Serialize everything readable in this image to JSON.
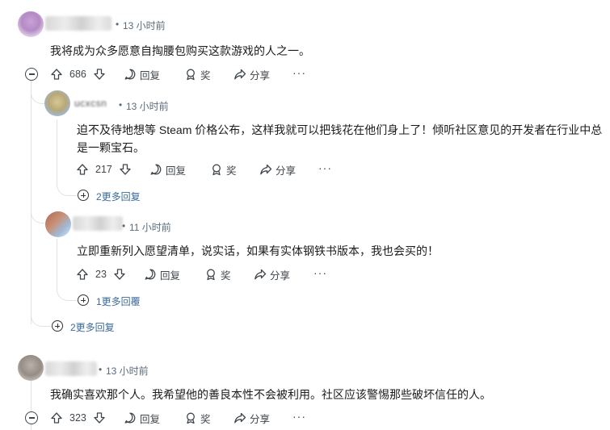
{
  "comments": [
    {
      "time": "13 小时前",
      "body": "我将成为众多愿意自掏腰包购买这款游戏的人之一。",
      "votes": "686",
      "reply": "回复",
      "award": "奖",
      "share": "分享",
      "more": "···"
    },
    {
      "username_partial": "ucxcsn",
      "time": "13 小时前",
      "body_line1": "迫不及待地想等 Steam 价格公布，这样我就可以把钱花在他们身上了！倾听社区意见的开发者在行业中总",
      "body_line2": "是一颗宝石。",
      "votes": "217",
      "reply": "回复",
      "award": "奖",
      "share": "分享",
      "more": "···",
      "more_replies": "2更多回复"
    },
    {
      "time": "11 小时前",
      "body": "立即重新列入愿望清单，说实话，如果有实体钢铁书版本，我也会买的！",
      "votes": "23",
      "reply": "回复",
      "award": "奖",
      "share": "分享",
      "more": "···",
      "more_replies": "1更多回覆"
    },
    {
      "more_replies": "2更多回复"
    },
    {
      "time": "13 小时前",
      "body": "我确实喜欢那个人。我希望他的善良本性不会被利用。社区应该警惕那些破坏信任的人。",
      "votes": "323",
      "reply": "回复",
      "award": "奖",
      "share": "分享",
      "more": "···"
    }
  ],
  "separator": "•",
  "colors": {
    "text": "#1c1c1c",
    "meta": "#5a6b7a",
    "thread_line": "#dfe3e6",
    "icon": "#40464c"
  }
}
